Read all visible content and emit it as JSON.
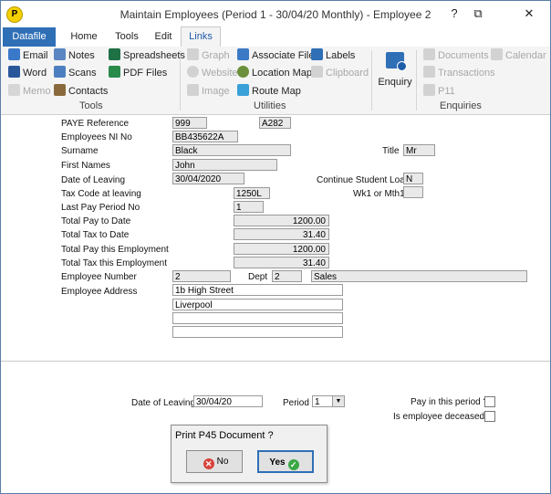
{
  "window": {
    "title": "Maintain Employees  (Period 1 - 30/04/20 Monthly) - Employee 2",
    "help_glyph": "?",
    "restore_glyph": "⧉",
    "close_glyph": "✕"
  },
  "tabs": [
    "Datafile",
    "Home",
    "Tools",
    "Edit",
    "Links"
  ],
  "active_tab": "Links",
  "ribbon": {
    "tools": {
      "label": "Tools",
      "items": [
        "Email",
        "Word",
        "Memo",
        "Notes",
        "Scans",
        "Contacts",
        "Spreadsheets",
        "PDF Files"
      ]
    },
    "utilities": {
      "label": "Utilities",
      "items": [
        "Graph",
        "Website",
        "Image",
        "Associate File",
        "Location Map",
        "Route Map",
        "Labels",
        "Clipboard"
      ]
    },
    "enquiries": {
      "label": "Enquiries",
      "enquiry": "Enquiry",
      "items": [
        "Documents",
        "Transactions",
        "P11",
        "Calendar"
      ]
    }
  },
  "form": {
    "paye_reference": {
      "label": "PAYE Reference",
      "value1": "999",
      "value2": "A282"
    },
    "ni_no": {
      "label": "Employees NI No",
      "value": "BB435622A"
    },
    "surname": {
      "label": "Surname",
      "value": "Black"
    },
    "title": {
      "label": "Title",
      "value": "Mr"
    },
    "first_names": {
      "label": "First Names",
      "value": "John"
    },
    "date_of_leaving": {
      "label": "Date of Leaving",
      "value": "30/04/2020"
    },
    "continue_student_loan": {
      "label": "Continue Student Loan",
      "value": "N"
    },
    "tax_code": {
      "label": "Tax Code at leaving",
      "value": "1250L"
    },
    "wk1_mth1": {
      "label": "Wk1 or Mth1",
      "value": ""
    },
    "last_pay_period": {
      "label": "Last Pay Period No",
      "value": "1"
    },
    "total_pay": {
      "label": "Total Pay to Date",
      "value": "1200.00"
    },
    "total_tax": {
      "label": "Total Tax to Date",
      "value": "31.40"
    },
    "total_pay_employment": {
      "label": "Total Pay this Employment",
      "value": "1200.00"
    },
    "total_tax_employment": {
      "label": "Total Tax this Employment",
      "value": "31.40"
    },
    "employee_number": {
      "label": "Employee Number",
      "value": "2"
    },
    "dept": {
      "label": "Dept",
      "code": "2",
      "name": "Sales"
    },
    "address": {
      "label": "Employee Address",
      "lines": [
        "1b High Street",
        "Liverpool",
        "",
        ""
      ]
    }
  },
  "bottom": {
    "date_of_leaving_label": "Date of Leaving",
    "date_of_leaving_value": "30/04/20",
    "period_label": "Period",
    "period_value": "1",
    "pay_in_period_label": "Pay in this period ?",
    "deceased_label": "Is employee deceased ?"
  },
  "dialog": {
    "prompt": "Print P45 Document ?",
    "no_label": "No",
    "yes_label": "Yes"
  },
  "colors": {
    "accent": "#2f6fb6",
    "field_bg": "#e9e9e9",
    "ribbon_bg": "#f4f4f4"
  }
}
